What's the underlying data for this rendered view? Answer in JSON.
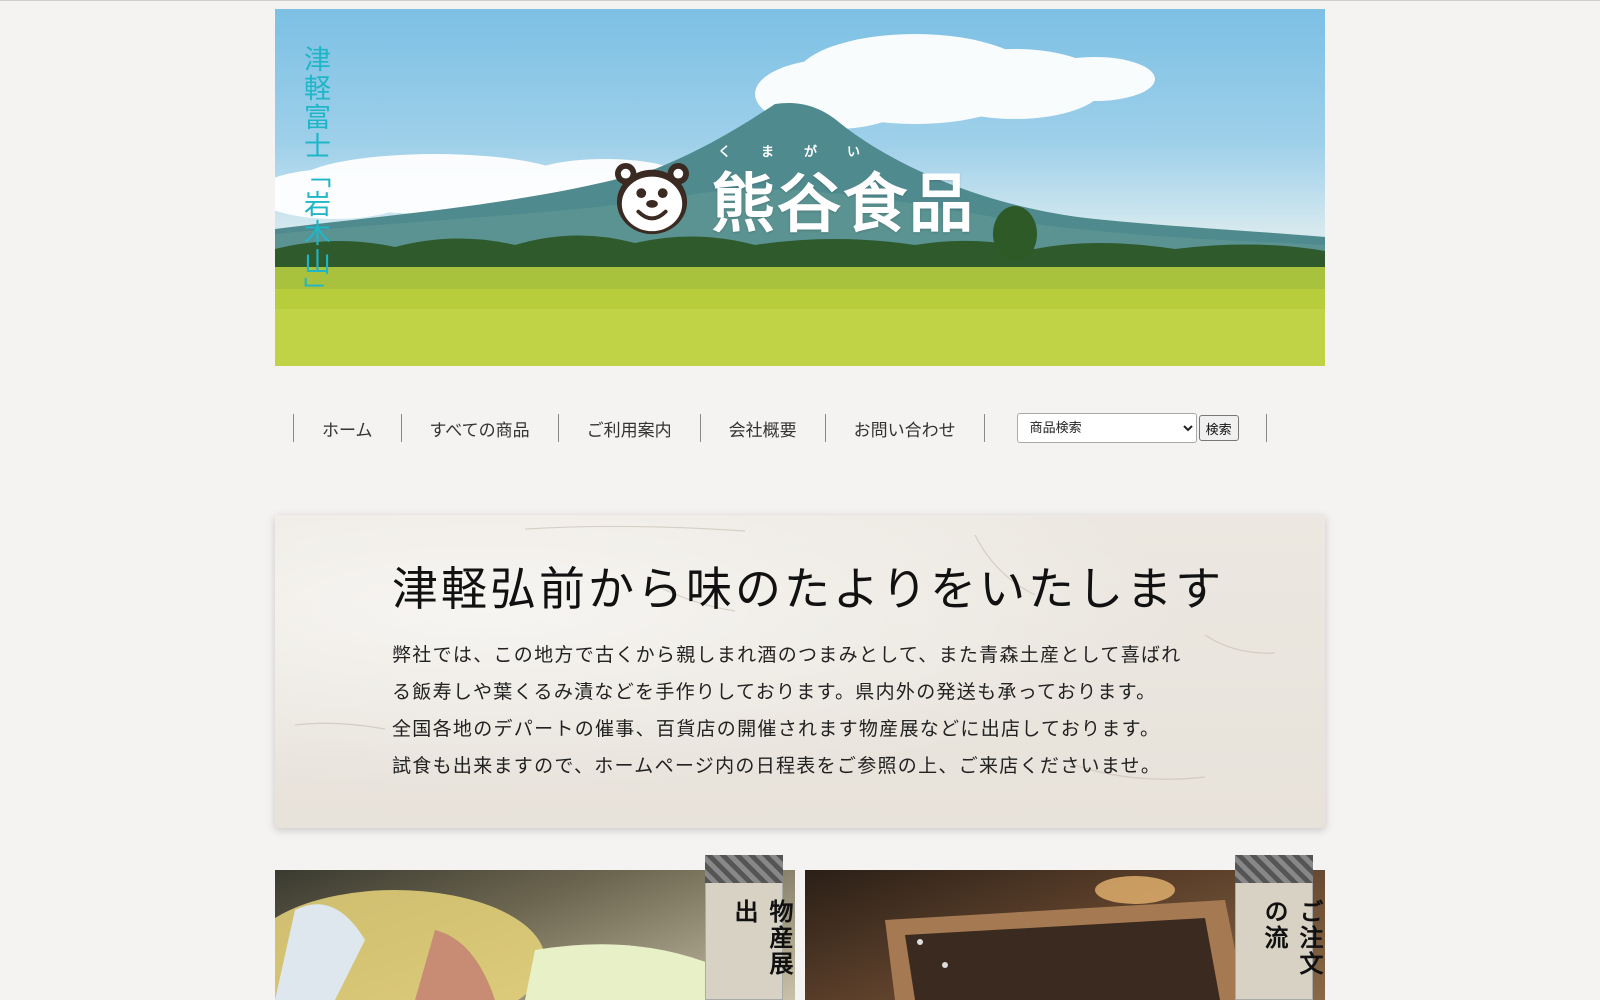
{
  "hero": {
    "vertical_title": "津軽富士「岩木山」",
    "brand_ruby": "くまがい",
    "brand_name": "熊谷食品"
  },
  "nav": {
    "items": [
      "ホーム",
      "すべての商品",
      "ご利用案内",
      "会社概要",
      "お問い合わせ"
    ],
    "search_select_value": "商品検索",
    "search_button": "検索"
  },
  "intro": {
    "heading": "津軽弘前から味のたよりをいたします",
    "lines": [
      "弊社では、この地方で古くから親しまれ酒のつまみとして、また青森土産として喜ばれ",
      "る飯寿しや葉くるみ漬などを手作りしております。県内外の発送も承っております。",
      "全国各地のデパートの催事、百貨店の開催されます物産展などに出店しております。",
      "試食も出来ますので、ホームページ内の日程表をご参照の上、ご来店くださいませ。"
    ]
  },
  "cards": {
    "left_tag": "物産展出",
    "right_tag": "ご注文の流"
  }
}
